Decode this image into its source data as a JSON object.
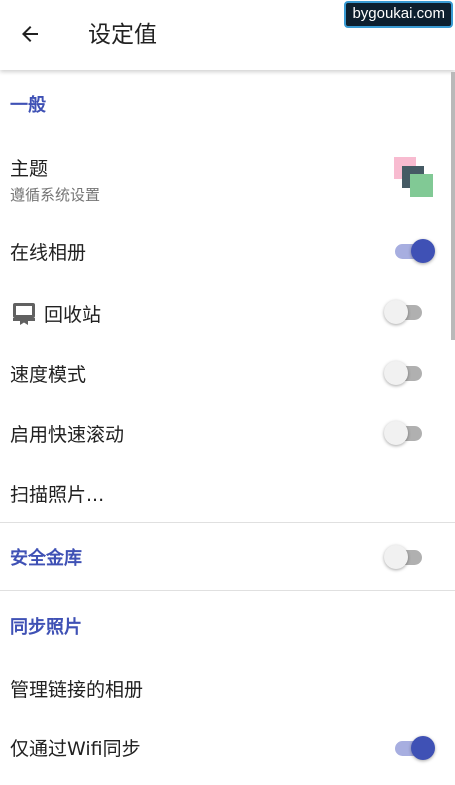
{
  "appbar": {
    "title": "设定值",
    "back_icon": "arrow-left-icon"
  },
  "watermark": "bygoukai.com",
  "sections": {
    "general": "一般",
    "vault": "安全金库",
    "sync": "同步照片"
  },
  "items": {
    "theme": {
      "title": "主题",
      "subtitle": "遵循系统设置",
      "swatch_colors": [
        "#f8bbd0",
        "#455a64",
        "#81c995"
      ]
    },
    "online_album": {
      "title": "在线相册",
      "enabled": true
    },
    "trash": {
      "title": "回收站",
      "enabled": false,
      "icon": "trash-bin-icon"
    },
    "speed_mode": {
      "title": "速度模式",
      "enabled": false
    },
    "fast_scroll": {
      "title": "启用快速滚动",
      "enabled": false
    },
    "scan_photos": {
      "title": "扫描照片..."
    },
    "vault": {
      "enabled": false
    },
    "manage_albums": {
      "title": "管理链接的相册"
    },
    "wifi_only": {
      "title": "仅通过Wifi同步",
      "enabled": true
    }
  },
  "colors": {
    "accent": "#3f51b5",
    "switch_off_track": "#b0b0b0",
    "switch_on_track": "#a7aee0"
  }
}
